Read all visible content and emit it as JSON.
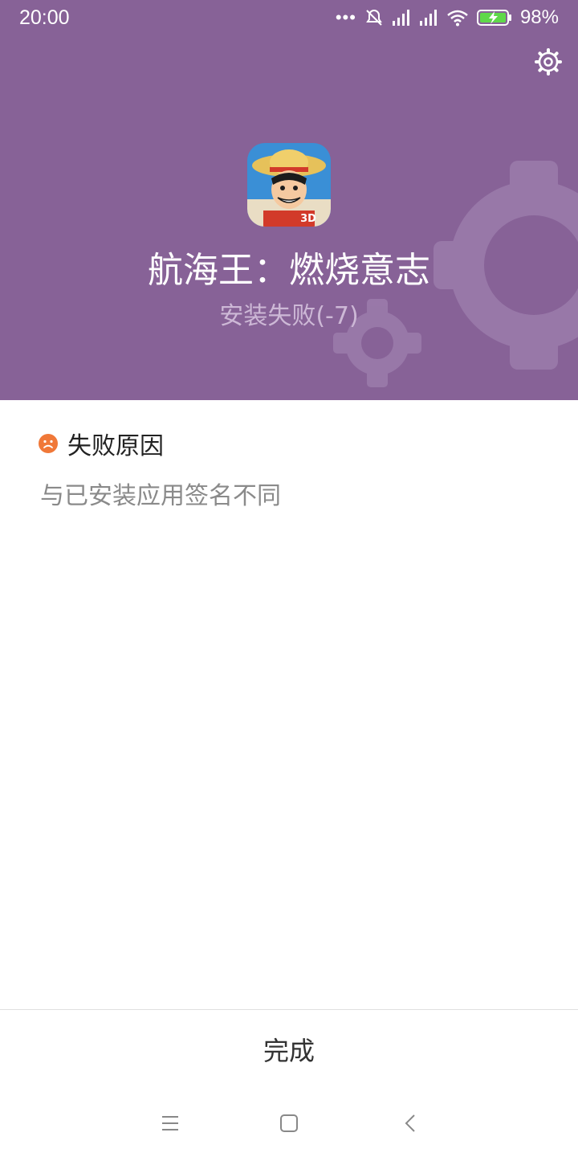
{
  "status_bar": {
    "time": "20:00",
    "battery_percent": "98%"
  },
  "app": {
    "name": "航海王：燃烧意志",
    "install_status": "安装失败(-7)",
    "icon_badge": "3D"
  },
  "failure": {
    "heading": "失败原因",
    "reason": "与已安装应用签名不同"
  },
  "actions": {
    "done_label": "完成"
  },
  "colors": {
    "header_bg": "#876297",
    "error_accent": "#f07838"
  }
}
